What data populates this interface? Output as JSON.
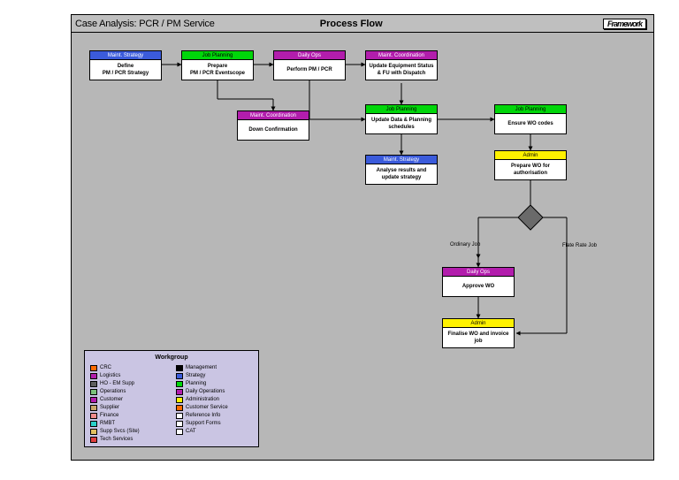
{
  "header": {
    "title_left": "Case Analysis: PCR / PM Service",
    "title_right": "Process Flow",
    "brand": "Framework"
  },
  "boxes": {
    "b1": {
      "head": "Maint. Strategy",
      "body": "Define\nPM / PCR Strategy"
    },
    "b2": {
      "head": "Job Planning",
      "body": "Prepare\nPM / PCR Eventscope"
    },
    "b3": {
      "head": "Daily Ops",
      "body": "Perform PM / PCR"
    },
    "b4": {
      "head": "Maint. Coordination",
      "body": "Update Equipment Status & FU with Dispatch"
    },
    "b5": {
      "head": "Maint. Coordination",
      "body": "Down Confirmation"
    },
    "b6": {
      "head": "Job Planning",
      "body": "Update Data & Planning schedules"
    },
    "b7": {
      "head": "Maint. Strategy",
      "body": "Analyse results and update strategy"
    },
    "b8": {
      "head": "Job Planning",
      "body": "Ensure WO codes"
    },
    "b9": {
      "head": "Admin",
      "body": "Prepare WO for authorisation"
    },
    "b10": {
      "head": "Daily Ops",
      "body": "Approve WO"
    },
    "b11": {
      "head": "Admin",
      "body": "Finalise WO and invoice job"
    }
  },
  "edges": {
    "ordinary": "Ordinary Job",
    "flatrate": "Flate Rate Job"
  },
  "legend": {
    "title": "Workgroup",
    "col1": [
      {
        "label": "CRC",
        "color": "#ff6a00"
      },
      {
        "label": "Logistics",
        "color": "#b21dac"
      },
      {
        "label": "HO - EM Supp",
        "color": "#5e5e5e"
      },
      {
        "label": "Operations",
        "color": "#7ac17a"
      },
      {
        "label": "Customer",
        "color": "#b21dac"
      },
      {
        "label": "Supplier",
        "color": "#c9a66b"
      },
      {
        "label": "Finance",
        "color": "#f08c8c"
      },
      {
        "label": "RMBT",
        "color": "#2ad1c9"
      },
      {
        "label": "Supp Svcs (Site)",
        "color": "#e0c060"
      },
      {
        "label": "Tech Services",
        "color": "#e04040"
      }
    ],
    "col2": [
      {
        "label": "Management",
        "color": "#000000"
      },
      {
        "label": "Strategy",
        "color": "#3b5bdb"
      },
      {
        "label": "Planning",
        "color": "#00d60a"
      },
      {
        "label": "Daily Operations",
        "color": "#b21dac"
      },
      {
        "label": "Administration",
        "color": "#fff200"
      },
      {
        "label": "Customer Service",
        "color": "#ff6a00"
      },
      {
        "label": "Reference Info",
        "color": "#ffffff"
      },
      {
        "label": "Support Forms",
        "color": "#ffffff"
      },
      {
        "label": "CAT",
        "color": "#ffffff"
      }
    ]
  }
}
